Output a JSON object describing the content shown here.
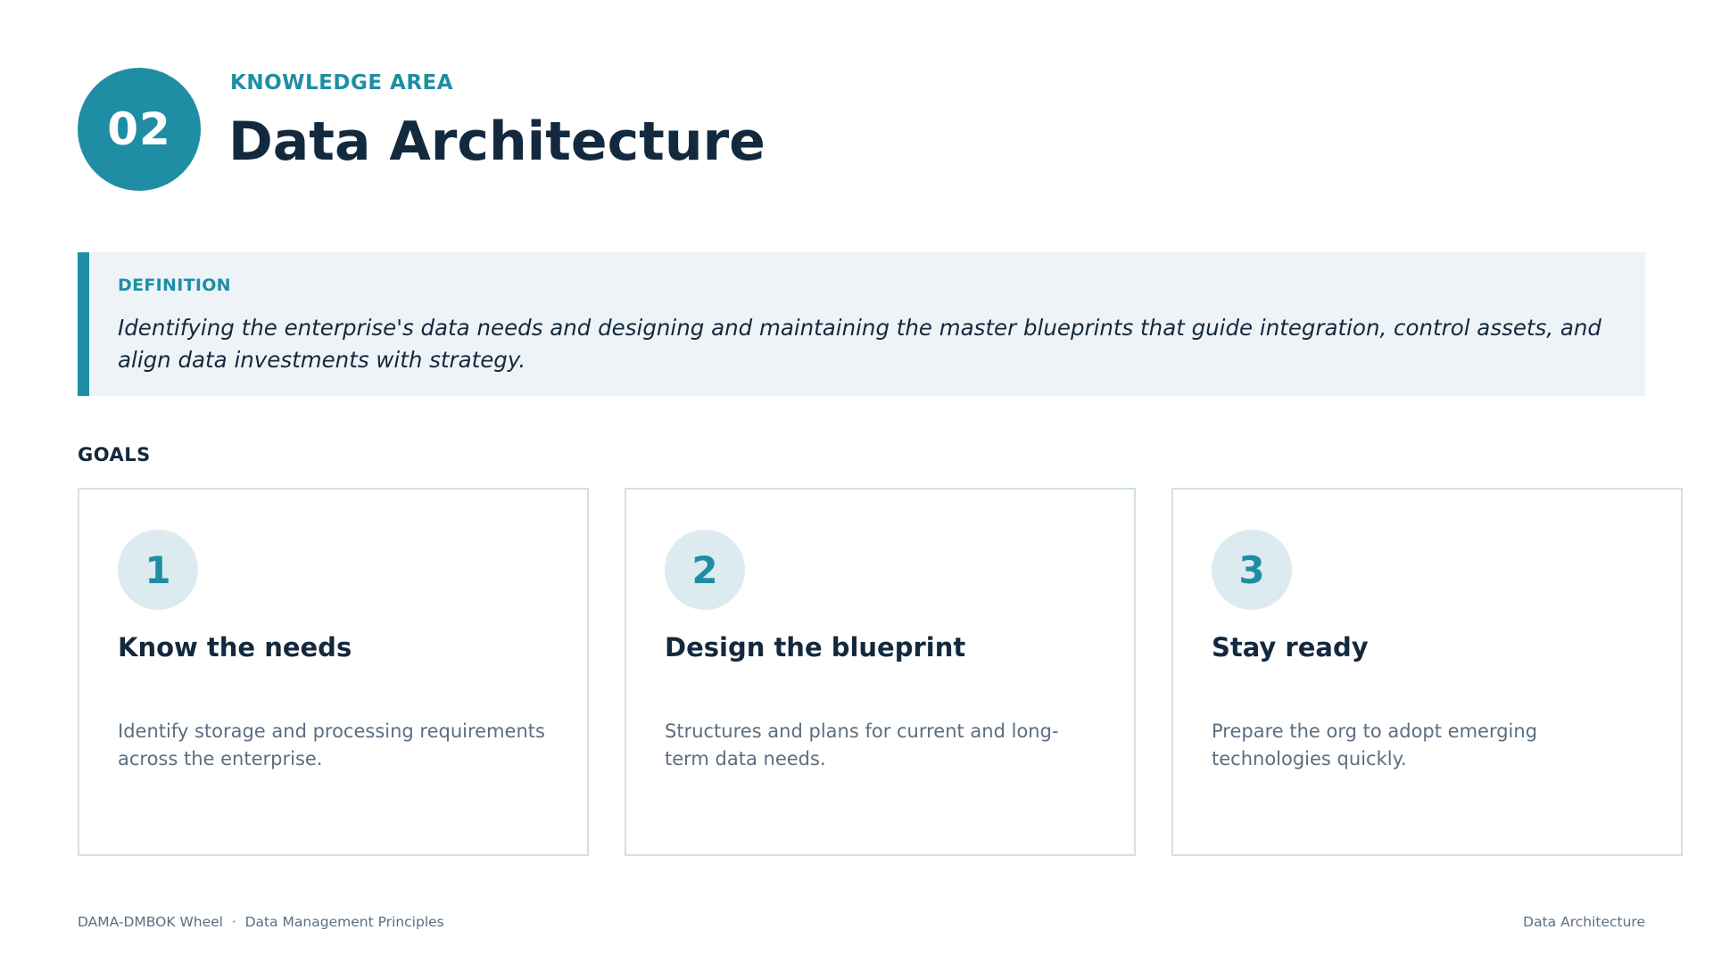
{
  "header": {
    "number": "02",
    "eyebrow": "KNOWLEDGE AREA",
    "title": "Data Architecture"
  },
  "definition": {
    "label": "DEFINITION",
    "text": "Identifying the enterprise's data needs and designing and maintaining the master blueprints that guide integration, control assets, and align data investments with strategy."
  },
  "goals": {
    "label": "GOALS",
    "items": [
      {
        "number": "1",
        "title": "Know the needs",
        "text": "Identify storage and processing requirements across the enterprise."
      },
      {
        "number": "2",
        "title": "Design the blueprint",
        "text": "Structures and plans for current and long-term data needs."
      },
      {
        "number": "3",
        "title": "Stay ready",
        "text": "Prepare the org to adopt emerging technologies quickly."
      }
    ]
  },
  "footer": {
    "left": "DAMA-DMBOK Wheel  ·  Data Management Principles",
    "right": "Data Architecture"
  },
  "colors": {
    "accent": "#1f8ea5",
    "heading": "#13293d",
    "body": "#5c6e80",
    "panel": "#eef3f7",
    "card_border": "#d3e0e6",
    "number_circle": "#dcebf0"
  }
}
